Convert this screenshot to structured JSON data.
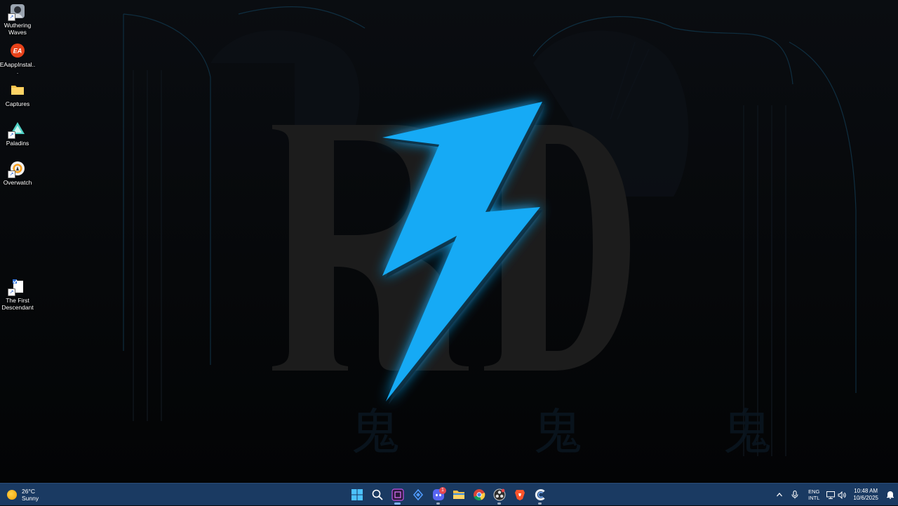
{
  "desktop": {
    "icons": [
      {
        "label": "Wuthering Waves",
        "icon": "wuthering-waves-icon",
        "shortcut": true
      },
      {
        "label": "EAappInstal...",
        "icon": "ea-app-icon",
        "shortcut": false
      },
      {
        "label": "Captures",
        "icon": "folder-icon",
        "shortcut": false
      },
      {
        "label": "Paladins",
        "icon": "paladins-icon",
        "shortcut": true
      },
      {
        "label": "Overwatch",
        "icon": "overwatch-icon",
        "shortcut": true
      },
      {
        "label": "The First Descendant",
        "icon": "the-first-descendant-icon",
        "shortcut": true
      }
    ]
  },
  "wallpaper": {
    "letters_left": "R",
    "letters_right": "D",
    "bolt_color": "#12aaf5",
    "letter_color": "#1b1b1b"
  },
  "taskbar": {
    "weather": {
      "temp": "26°C",
      "condition": "Sunny",
      "icon": "sun-icon"
    },
    "apps": [
      {
        "name": "start-button",
        "icon": "windows-start-icon",
        "state": ""
      },
      {
        "name": "search-button",
        "icon": "search-icon",
        "state": ""
      },
      {
        "name": "taskbar-app-pinned",
        "icon": "app-square-icon",
        "state": "active"
      },
      {
        "name": "taskbar-app-blue-diamond",
        "icon": "blue-diamond-icon",
        "state": ""
      },
      {
        "name": "taskbar-app-discord",
        "icon": "discord-icon",
        "state": "running",
        "badge": "1"
      },
      {
        "name": "taskbar-app-file-explorer",
        "icon": "file-explorer-icon",
        "state": ""
      },
      {
        "name": "taskbar-app-chrome",
        "icon": "chrome-icon",
        "state": ""
      },
      {
        "name": "taskbar-app-obs",
        "icon": "obs-icon",
        "state": "running"
      },
      {
        "name": "taskbar-app-brave",
        "icon": "brave-icon",
        "state": ""
      },
      {
        "name": "taskbar-app-c",
        "icon": "c-app-icon",
        "state": "running"
      }
    ],
    "tray": {
      "lang_top": "ENG",
      "lang_bottom": "INTL",
      "time": "10:48 AM",
      "date": "10/6/2025"
    },
    "accent": "#1a3a62"
  }
}
